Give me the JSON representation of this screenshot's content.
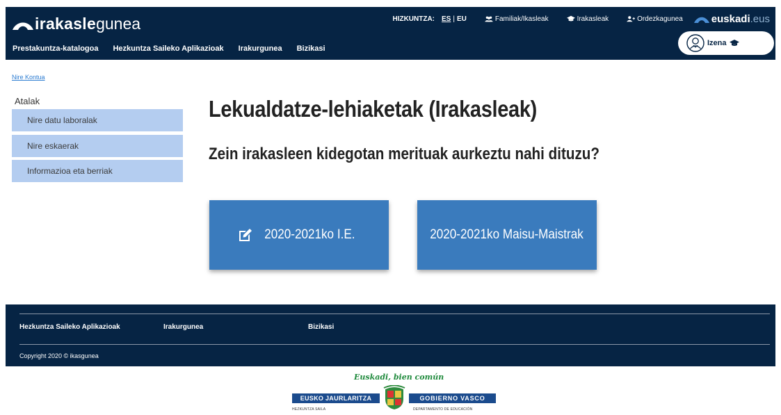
{
  "header": {
    "logo_brand": "irakasle",
    "logo_suffix": "gunea",
    "language_label": "HIZKUNTZA:",
    "languages": [
      {
        "code": "ES",
        "active": true
      },
      {
        "code": "EU",
        "active": false
      }
    ],
    "top_links": [
      {
        "label": "Familiak/Ikasleak",
        "icon": "users-icon"
      },
      {
        "label": "Irakasleak",
        "icon": "graduation-cap-icon"
      },
      {
        "label": "Ordezkagunea",
        "icon": "user-plus-icon"
      }
    ],
    "euskadi_brand": "euskadi",
    "euskadi_suffix": ".eus",
    "nav": [
      "Prestakuntza-katalogoa",
      "Hezkuntza Saileko Aplikazioak",
      "Irakurgunea",
      "Bizikasi"
    ],
    "user_name": "Izena"
  },
  "breadcrumb": "Nire Kontua",
  "sidebar": {
    "title": "Atalak",
    "items": [
      {
        "label": "Nire datu laboralak"
      },
      {
        "label": "Nire eskaerak"
      },
      {
        "label": "Informazioa eta berriak"
      }
    ]
  },
  "main": {
    "title": "Lekualdatze-lehiaketak (Irakasleak)",
    "subtitle": "Zein irakasleen kidegotan merituak aurkeztu nahi dituzu?",
    "buttons": [
      {
        "label": "2020-2021ko I.E.",
        "icon": "edit-icon"
      },
      {
        "label": "2020-2021ko Maisu-Maistrak"
      }
    ]
  },
  "footer": {
    "links": [
      "Hezkuntza Saileko Aplikazioak",
      "Irakurgunea",
      "Bizikasi"
    ],
    "copyright": "Copyright 2020 © ikasgunea"
  },
  "government": {
    "slogan": "Euskadi, bien común",
    "left_name": "EUSKO JAURLARITZA",
    "right_name": "GOBIERNO VASCO",
    "left_dept": "HEZKUNTZA SAILA",
    "right_dept": "DEPARTAMENTO DE EDUCACIÓN"
  },
  "colors": {
    "header_bg": "#062444",
    "button_bg": "#3a7bbd",
    "sidebar_item_bg": "#b4cdf0",
    "link": "#2b7bd1"
  }
}
